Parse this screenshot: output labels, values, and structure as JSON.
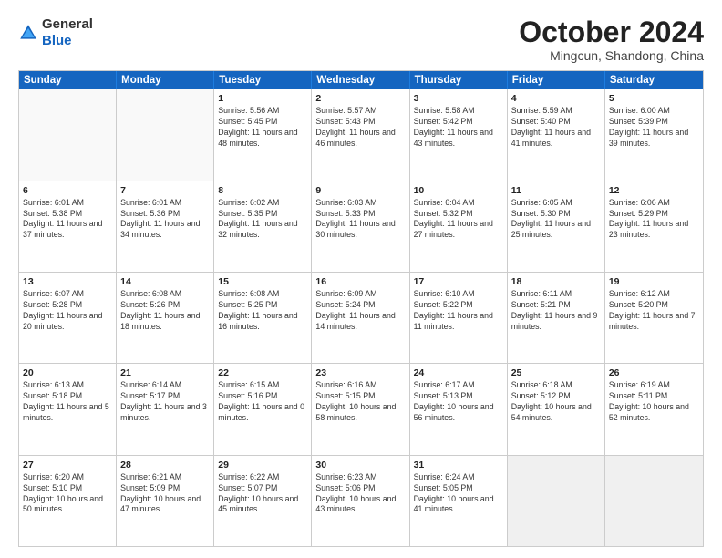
{
  "header": {
    "logo_general": "General",
    "logo_blue": "Blue",
    "month": "October 2024",
    "location": "Mingcun, Shandong, China"
  },
  "weekdays": [
    "Sunday",
    "Monday",
    "Tuesday",
    "Wednesday",
    "Thursday",
    "Friday",
    "Saturday"
  ],
  "rows": [
    [
      {
        "day": "",
        "text": "",
        "empty": true
      },
      {
        "day": "",
        "text": "",
        "empty": true
      },
      {
        "day": "1",
        "text": "Sunrise: 5:56 AM\nSunset: 5:45 PM\nDaylight: 11 hours and 48 minutes."
      },
      {
        "day": "2",
        "text": "Sunrise: 5:57 AM\nSunset: 5:43 PM\nDaylight: 11 hours and 46 minutes."
      },
      {
        "day": "3",
        "text": "Sunrise: 5:58 AM\nSunset: 5:42 PM\nDaylight: 11 hours and 43 minutes."
      },
      {
        "day": "4",
        "text": "Sunrise: 5:59 AM\nSunset: 5:40 PM\nDaylight: 11 hours and 41 minutes."
      },
      {
        "day": "5",
        "text": "Sunrise: 6:00 AM\nSunset: 5:39 PM\nDaylight: 11 hours and 39 minutes."
      }
    ],
    [
      {
        "day": "6",
        "text": "Sunrise: 6:01 AM\nSunset: 5:38 PM\nDaylight: 11 hours and 37 minutes."
      },
      {
        "day": "7",
        "text": "Sunrise: 6:01 AM\nSunset: 5:36 PM\nDaylight: 11 hours and 34 minutes."
      },
      {
        "day": "8",
        "text": "Sunrise: 6:02 AM\nSunset: 5:35 PM\nDaylight: 11 hours and 32 minutes."
      },
      {
        "day": "9",
        "text": "Sunrise: 6:03 AM\nSunset: 5:33 PM\nDaylight: 11 hours and 30 minutes."
      },
      {
        "day": "10",
        "text": "Sunrise: 6:04 AM\nSunset: 5:32 PM\nDaylight: 11 hours and 27 minutes."
      },
      {
        "day": "11",
        "text": "Sunrise: 6:05 AM\nSunset: 5:30 PM\nDaylight: 11 hours and 25 minutes."
      },
      {
        "day": "12",
        "text": "Sunrise: 6:06 AM\nSunset: 5:29 PM\nDaylight: 11 hours and 23 minutes."
      }
    ],
    [
      {
        "day": "13",
        "text": "Sunrise: 6:07 AM\nSunset: 5:28 PM\nDaylight: 11 hours and 20 minutes."
      },
      {
        "day": "14",
        "text": "Sunrise: 6:08 AM\nSunset: 5:26 PM\nDaylight: 11 hours and 18 minutes."
      },
      {
        "day": "15",
        "text": "Sunrise: 6:08 AM\nSunset: 5:25 PM\nDaylight: 11 hours and 16 minutes."
      },
      {
        "day": "16",
        "text": "Sunrise: 6:09 AM\nSunset: 5:24 PM\nDaylight: 11 hours and 14 minutes."
      },
      {
        "day": "17",
        "text": "Sunrise: 6:10 AM\nSunset: 5:22 PM\nDaylight: 11 hours and 11 minutes."
      },
      {
        "day": "18",
        "text": "Sunrise: 6:11 AM\nSunset: 5:21 PM\nDaylight: 11 hours and 9 minutes."
      },
      {
        "day": "19",
        "text": "Sunrise: 6:12 AM\nSunset: 5:20 PM\nDaylight: 11 hours and 7 minutes."
      }
    ],
    [
      {
        "day": "20",
        "text": "Sunrise: 6:13 AM\nSunset: 5:18 PM\nDaylight: 11 hours and 5 minutes."
      },
      {
        "day": "21",
        "text": "Sunrise: 6:14 AM\nSunset: 5:17 PM\nDaylight: 11 hours and 3 minutes."
      },
      {
        "day": "22",
        "text": "Sunrise: 6:15 AM\nSunset: 5:16 PM\nDaylight: 11 hours and 0 minutes."
      },
      {
        "day": "23",
        "text": "Sunrise: 6:16 AM\nSunset: 5:15 PM\nDaylight: 10 hours and 58 minutes."
      },
      {
        "day": "24",
        "text": "Sunrise: 6:17 AM\nSunset: 5:13 PM\nDaylight: 10 hours and 56 minutes."
      },
      {
        "day": "25",
        "text": "Sunrise: 6:18 AM\nSunset: 5:12 PM\nDaylight: 10 hours and 54 minutes."
      },
      {
        "day": "26",
        "text": "Sunrise: 6:19 AM\nSunset: 5:11 PM\nDaylight: 10 hours and 52 minutes."
      }
    ],
    [
      {
        "day": "27",
        "text": "Sunrise: 6:20 AM\nSunset: 5:10 PM\nDaylight: 10 hours and 50 minutes."
      },
      {
        "day": "28",
        "text": "Sunrise: 6:21 AM\nSunset: 5:09 PM\nDaylight: 10 hours and 47 minutes."
      },
      {
        "day": "29",
        "text": "Sunrise: 6:22 AM\nSunset: 5:07 PM\nDaylight: 10 hours and 45 minutes."
      },
      {
        "day": "30",
        "text": "Sunrise: 6:23 AM\nSunset: 5:06 PM\nDaylight: 10 hours and 43 minutes."
      },
      {
        "day": "31",
        "text": "Sunrise: 6:24 AM\nSunset: 5:05 PM\nDaylight: 10 hours and 41 minutes."
      },
      {
        "day": "",
        "text": "",
        "empty": true
      },
      {
        "day": "",
        "text": "",
        "empty": true
      }
    ]
  ]
}
